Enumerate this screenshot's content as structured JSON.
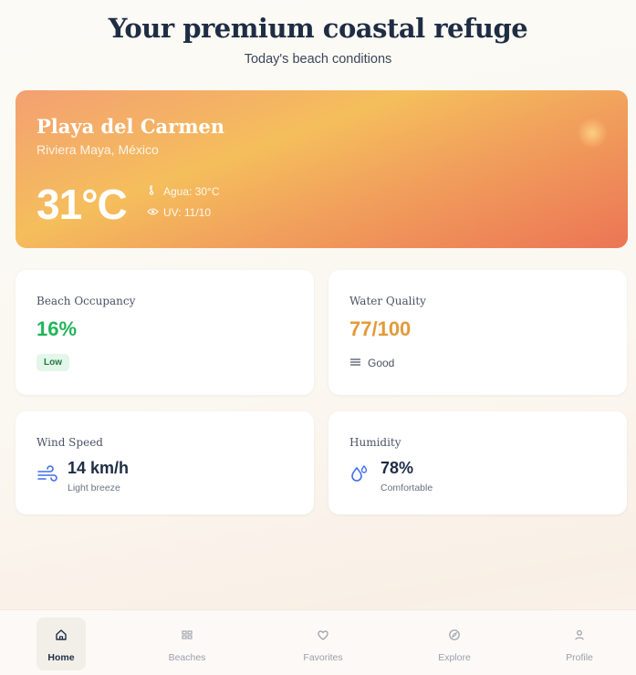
{
  "header": {
    "title": "Your premium coastal refuge",
    "subtitle": "Today's beach conditions"
  },
  "hero": {
    "city": "Playa del Carmen",
    "region": "Riviera Maya, México",
    "temperature": "31°C",
    "water_icon": "thermometer-icon",
    "water": "Agua: 30°C",
    "uv_icon": "eye-icon",
    "uv": "UV: 11/10",
    "accent_from": "#f5be5c",
    "accent_to": "#ec7555"
  },
  "cards": {
    "occupancy": {
      "label": "Beach Occupancy",
      "value": "16%",
      "badge": "Low",
      "color": "#22b55a"
    },
    "water_quality": {
      "label": "Water Quality",
      "value": "77/100",
      "status_icon": "waves-icon",
      "status": "Good",
      "color": "#e39a3a"
    },
    "wind": {
      "label": "Wind Speed",
      "icon": "wind-icon",
      "value": "14 km/h",
      "note": "Light breeze"
    },
    "humidity": {
      "label": "Humidity",
      "icon": "droplets-icon",
      "value": "78%",
      "note": "Comfortable"
    }
  },
  "nav": {
    "items": [
      {
        "label": "Home",
        "icon": "home-icon",
        "active": true
      },
      {
        "label": "Beaches",
        "icon": "grid-icon",
        "active": false
      },
      {
        "label": "Favorites",
        "icon": "heart-icon",
        "active": false
      },
      {
        "label": "Explore",
        "icon": "compass-icon",
        "active": false
      },
      {
        "label": "Profile",
        "icon": "user-icon",
        "active": false
      }
    ]
  }
}
